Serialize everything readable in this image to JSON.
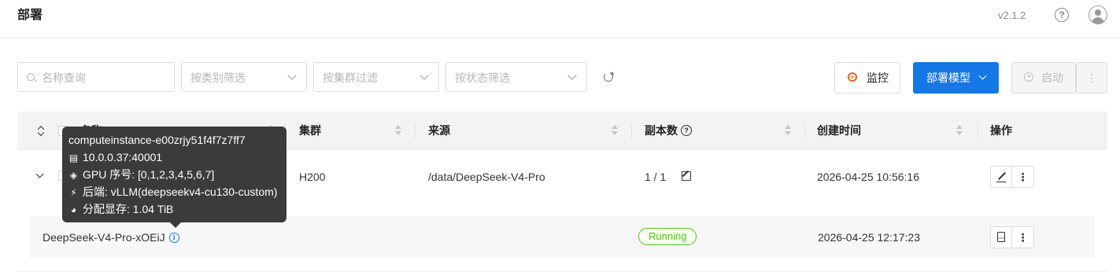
{
  "header": {
    "title": "部署",
    "version": "v2.1.2",
    "help": "?"
  },
  "filters": {
    "name_placeholder": "名称查询",
    "category_placeholder": "按类别筛选",
    "cluster_placeholder": "按集群过滤",
    "status_placeholder": "按状态筛选"
  },
  "toolbar": {
    "monitor_label": "监控",
    "deploy_label": "部署模型",
    "start_label": "启动",
    "more_label": "⋮"
  },
  "table": {
    "columns": {
      "name": "名称",
      "cluster": "集群",
      "source": "来源",
      "replicas": "副本数",
      "created": "创建时间",
      "actions": "操作"
    },
    "rows": [
      {
        "cluster": "H200",
        "source": "/data/DeepSeek-V4-Pro",
        "replicas": "1 / 1",
        "created": "2026-04-25 10:56:16",
        "instances": [
          {
            "name": "DeepSeek-V4-Pro-xOEiJ",
            "status": "Running",
            "created": "2026-04-25 12:17:23"
          }
        ]
      }
    ]
  },
  "tooltip": {
    "instance": "computeinstance-e00zrjy51f4f7z7ff7",
    "address": "10.0.0.37:40001",
    "gpu": "GPU 序号: [0,1,2,3,4,5,6,7]",
    "backend": "后端: vLLM(deepseekv4-cu130-custom)",
    "memory": "分配显存: 1.04 TiB"
  },
  "colors": {
    "primary": "#1677e6",
    "running": "#52c41a",
    "tooltip_bg": "#3b3b3b",
    "monitor_icon": "#e8632c"
  }
}
